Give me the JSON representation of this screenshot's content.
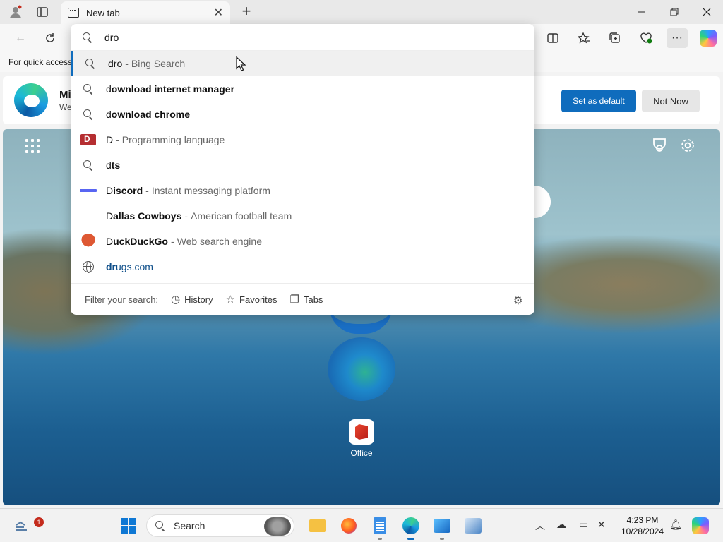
{
  "browser": {
    "tab_title": "New tab",
    "favorites_bar_text": "For quick access"
  },
  "banner": {
    "title": "Mi",
    "subtitle": "We",
    "set_default_label": "Set as default",
    "not_now_label": "Not Now"
  },
  "omnibox": {
    "input_value": "dro",
    "suggestions": [
      {
        "prefix": "dro",
        "rest": "",
        "description": "Bing Search",
        "icon": "search-icon"
      },
      {
        "prefix": "d",
        "rest": "ownload internet manager",
        "description": "",
        "icon": "search-icon"
      },
      {
        "prefix": "d",
        "rest": "ownload chrome",
        "description": "",
        "icon": "search-icon"
      },
      {
        "prefix": "D",
        "rest": "",
        "description": "Programming language",
        "icon": "d-language-logo"
      },
      {
        "prefix": "d",
        "rest": "ts",
        "description": "",
        "icon": "search-icon"
      },
      {
        "prefix": "D",
        "rest": "iscord",
        "description": "Instant messaging platform",
        "icon": "discord-logo"
      },
      {
        "prefix": "D",
        "rest": "allas Cowboys",
        "description": "American football team",
        "icon": ""
      },
      {
        "prefix": "D",
        "rest": "uckDuckGo",
        "description": "Web search engine",
        "icon": "duckduckgo-logo"
      },
      {
        "prefix": "dr",
        "rest": "ugs.com",
        "description": "",
        "icon": "globe-icon"
      }
    ],
    "filter_label": "Filter your search:",
    "filter_history": "History",
    "filter_favorites": "Favorites",
    "filter_tabs": "Tabs"
  },
  "new_tab_page": {
    "office_label": "Office"
  },
  "taskbar": {
    "search_label": "Search",
    "time": "4:23 PM",
    "date": "10/28/2024",
    "widgets_badge": "1"
  }
}
